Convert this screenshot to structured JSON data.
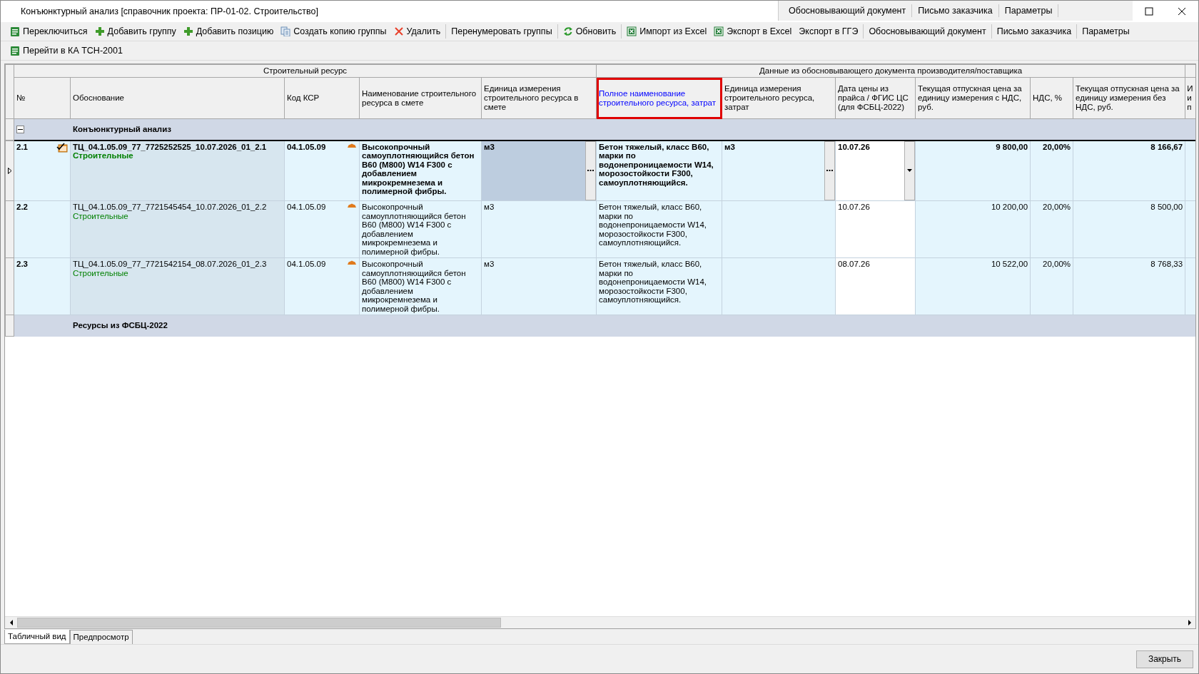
{
  "window": {
    "title": "Конъюнктурный анализ [справочник проекта: ПР-01-02. Строительство]"
  },
  "title_tabs": [
    "Обосновывающий документ",
    "Письмо заказчика",
    "Параметры"
  ],
  "toolbar": [
    {
      "label": "Переключиться",
      "kind": "ka",
      "divider_before": false
    },
    {
      "label": "Добавить группу",
      "kind": "add",
      "divider_before": false
    },
    {
      "label": "Добавить позицию",
      "kind": "add",
      "divider_before": false
    },
    {
      "label": "Создать копию группы",
      "kind": "copy",
      "divider_before": false
    },
    {
      "label": "Удалить",
      "kind": "delete",
      "divider_before": false
    },
    {
      "label": "Перенумеровать группы",
      "kind": "plain",
      "divider_before": true
    },
    {
      "label": "Обновить",
      "kind": "refresh",
      "divider_before": true
    },
    {
      "label": "Импорт из Excel",
      "kind": "excel",
      "divider_before": true
    },
    {
      "label": "Экспорт в Excel",
      "kind": "excel",
      "divider_before": false
    },
    {
      "label": "Экспорт в ГГЭ",
      "kind": "plain",
      "divider_before": false
    },
    {
      "label": "Обосновывающий документ",
      "kind": "plain",
      "divider_before": true
    },
    {
      "label": "Письмо заказчика",
      "kind": "plain",
      "divider_before": true
    },
    {
      "label": "Параметры",
      "kind": "plain",
      "divider_before": true
    }
  ],
  "toolbar_2": [
    {
      "label": "Перейти в КА ТСН-2001",
      "kind": "ka",
      "divider_before": false
    }
  ],
  "grid": {
    "column_groups": [
      {
        "label": "Строительный ресурс",
        "columns": [
          {
            "label": "№",
            "highlighted": false
          },
          {
            "label": "Обоснование",
            "highlighted": false
          },
          {
            "label": "Код КСР",
            "highlighted": false
          },
          {
            "label": "Наименование строительного ресурса в смете",
            "highlighted": false
          },
          {
            "label": "Единица измерения строительного ресурса в смете",
            "highlighted": false
          }
        ]
      },
      {
        "label": "Данные из обосновывающего документа производителя/поставщика",
        "columns": [
          {
            "label": "Полное наименование строительного ресурса, затрат",
            "highlighted": true
          },
          {
            "label": "Единица измерения строительного ресурса, затрат",
            "highlighted": false
          },
          {
            "label": "Дата цены из прайса / ФГИС ЦС (для ФСБЦ-2022)",
            "highlighted": false
          },
          {
            "label": "Текущая отпускная цена за единицу измерения с НДС, руб.",
            "highlighted": false
          },
          {
            "label": "НДС, %",
            "highlighted": false
          },
          {
            "label": "Текущая отпускная цена за единицу измерения без НДС, руб.",
            "highlighted": false
          }
        ]
      },
      {
        "columns": [
          {
            "label": "И и п",
            "highlighted": false
          }
        ]
      }
    ],
    "groups": [
      {
        "label": "Конъюнктурный анализ",
        "expanded": true,
        "rows": [
          {
            "number": "2.1",
            "selected": true,
            "checked": true,
            "basis": "ТЦ_04.1.05.09_77_7725252525_10.07.2026_01_2.1",
            "category": "Строительные",
            "code": "04.1.05.09",
            "name": "Высокопрочный самоуплотняющийся бетон В60 (М800) W14 F300 с добавлением микрокремнезема и полимерной фибры.",
            "unit": "м3",
            "full_name": "Бетон тяжелый, класс В60, марки по водонепроницаемости W14, морозостойкости F300, самоуплотняющийся.",
            "unit_2": "м3",
            "date": "10.07.26",
            "price_vat": "9 800,00",
            "vat": "20,00%",
            "price_no_vat": "8 166,67"
          },
          {
            "number": "2.2",
            "selected": false,
            "checked": false,
            "basis": "ТЦ_04.1.05.09_77_7721545454_10.07.2026_01_2.2",
            "category": "Строительные",
            "code": "04.1.05.09",
            "name": "Высокопрочный самоуплотняющийся бетон В60 (М800) W14 F300 с добавлением микрокремнезема и полимерной фибры.",
            "unit": "м3",
            "full_name": "Бетон тяжелый, класс В60, марки по водонепроницаемости W14, морозостойкости F300, самоуплотняющийся.",
            "date": "10.07.26",
            "price_vat": "10 200,00",
            "vat": "20,00%",
            "price_no_vat": "8 500,00"
          },
          {
            "number": "2.3",
            "selected": false,
            "checked": false,
            "basis": "ТЦ_04.1.05.09_77_7721542154_08.07.2026_01_2.3",
            "category": "Строительные",
            "code": "04.1.05.09",
            "name": "Высокопрочный самоуплотняющийся бетон В60 (М800) W14 F300 с добавлением микрокремнезема и полимерной фибры.",
            "unit": "м3",
            "full_name": "Бетон тяжелый, класс В60, марки по водонепроницаемости W14, морозостойкости F300, самоуплотняющийся.",
            "date": "08.07.26",
            "price_vat": "10 522,00",
            "vat": "20,00%",
            "price_no_vat": "8 768,33"
          }
        ]
      },
      {
        "label": "Ресурсы из ФСБЦ-2022"
      }
    ]
  },
  "bottom_tabs": [
    {
      "label": "Табличный вид",
      "selected": true
    },
    {
      "label": "Предпросмотр",
      "selected": false
    }
  ],
  "close_button": "Закрыть"
}
